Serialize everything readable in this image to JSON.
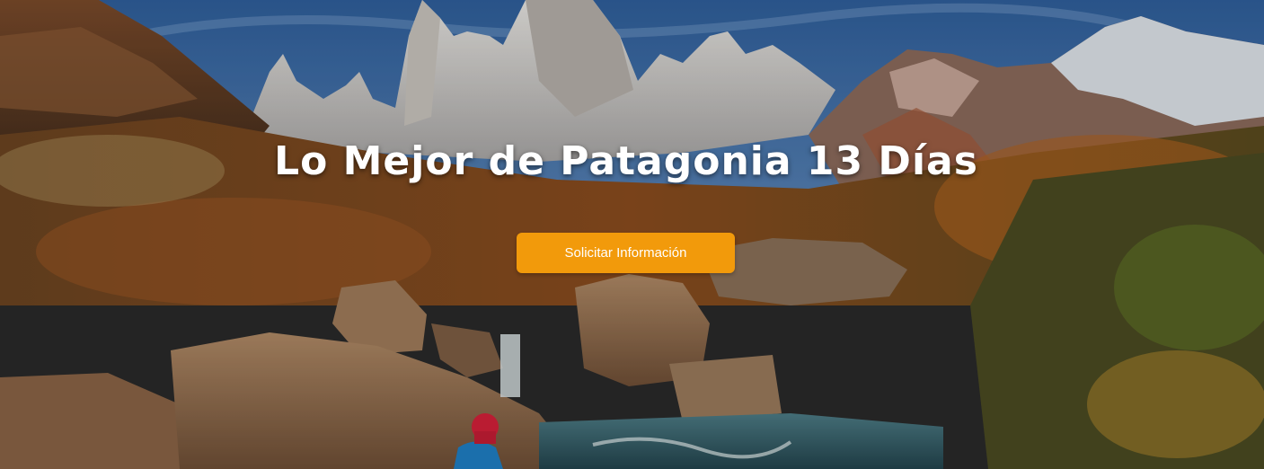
{
  "hero": {
    "title": "Lo Mejor de Patagonia 13 Días",
    "cta_label": "Solicitar Información",
    "cta_color": "#F29A0B",
    "image_name": "patagonia-landscape-image"
  }
}
